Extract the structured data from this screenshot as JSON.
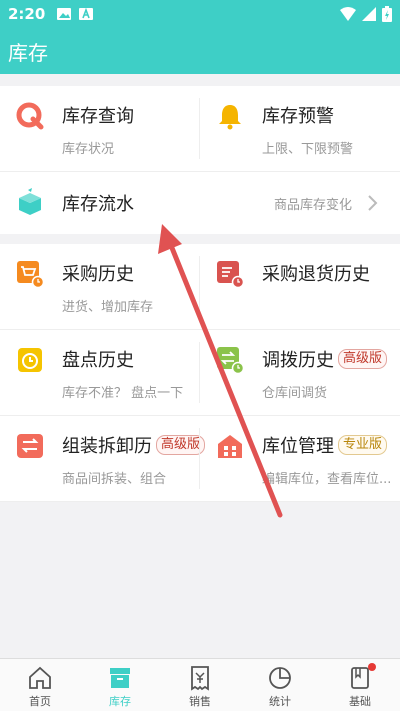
{
  "status_bar": {
    "time": "2:20"
  },
  "app_bar": {
    "title": "库存"
  },
  "grid_top": [
    {
      "title": "库存查询",
      "sub": "库存状况",
      "icon": "search-q-icon",
      "color": "#f26b5b"
    },
    {
      "title": "库存预警",
      "sub": "上限、下限预警",
      "icon": "bell-icon",
      "color": "#f5b400"
    }
  ],
  "flow_row": {
    "title": "库存流水",
    "hint": "商品库存变化",
    "icon": "box-icon",
    "color": "#3ecfc6"
  },
  "grid_main": [
    {
      "title": "采购历史",
      "sub": "进货、增加库存",
      "icon": "cart-history-icon",
      "color": "#f58a1f"
    },
    {
      "title": "采购退货历史",
      "sub": "",
      "icon": "return-history-icon",
      "color": "#d9534f"
    },
    {
      "title": "盘点历史",
      "sub": "库存不准？  盘点一下",
      "icon": "clock-clipboard-icon",
      "color": "#f5c400"
    },
    {
      "title": "调拨历史",
      "badge": "高级版",
      "sub": "仓库间调货",
      "icon": "transfer-icon",
      "color": "#8bc34a"
    },
    {
      "title": "组装拆卸历",
      "badge": "高级版",
      "sub": "商品间拆装、组合",
      "icon": "swap-icon",
      "color": "#f26b5b"
    },
    {
      "title": "库位管理",
      "badge": "专业版",
      "sub": "编辑库位，查看库位...",
      "icon": "warehouse-icon",
      "color": "#f26b5b"
    }
  ],
  "tabs": [
    {
      "label": "首页",
      "icon": "home-icon"
    },
    {
      "label": "库存",
      "icon": "inventory-icon",
      "active": true
    },
    {
      "label": "销售",
      "icon": "receipt-icon"
    },
    {
      "label": "统计",
      "icon": "pie-chart-icon"
    },
    {
      "label": "基础",
      "icon": "book-icon",
      "notification_dot": true
    }
  ],
  "colors": {
    "accent": "#3ecfc6",
    "annotation_arrow": "#e05252"
  }
}
